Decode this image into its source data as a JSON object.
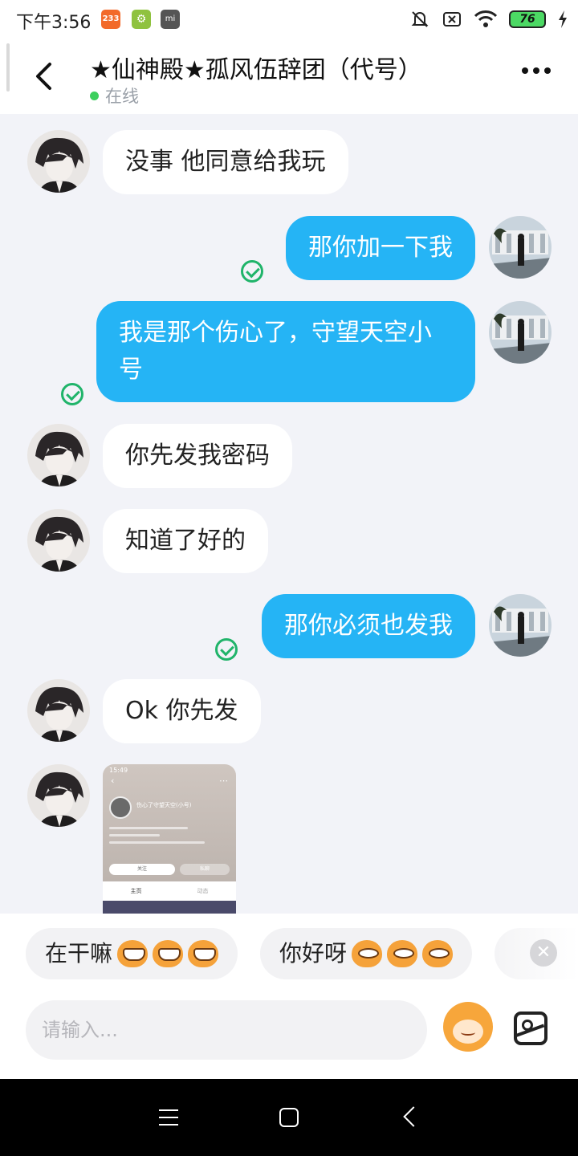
{
  "status_bar": {
    "time": "下午3:56",
    "app_badge_text": "233",
    "mi_badge_text": "mi",
    "battery": "76"
  },
  "header": {
    "title": "★仙神殿★孤风伍辞团（代号）",
    "status": "在线"
  },
  "messages": [
    {
      "side": "in",
      "text": "没事 他同意给我玩"
    },
    {
      "side": "out",
      "text": "那你加一下我"
    },
    {
      "side": "out",
      "text": "我是那个伤心了，守望天空小号"
    },
    {
      "side": "in",
      "text": "你先发我密码"
    },
    {
      "side": "in",
      "text": "知道了好的"
    },
    {
      "side": "out",
      "text": "那你必须也发我"
    },
    {
      "side": "in",
      "text": "Ok 你先发"
    }
  ],
  "shared_image": {
    "time": "15:49",
    "profile_name": "伤心了守望天空(小号)",
    "button_follow": "关注",
    "button_message": "私聊",
    "tab_home": "主页",
    "tab_feed": "动态"
  },
  "quick_replies": [
    {
      "text": "在干嘛"
    },
    {
      "text": "你好呀"
    }
  ],
  "input": {
    "placeholder": "请输入..."
  },
  "colors": {
    "outgoing_bubble": "#25b4f5",
    "incoming_bubble": "#ffffff",
    "online": "#3ccf5d",
    "read_check": "#20b46a"
  }
}
